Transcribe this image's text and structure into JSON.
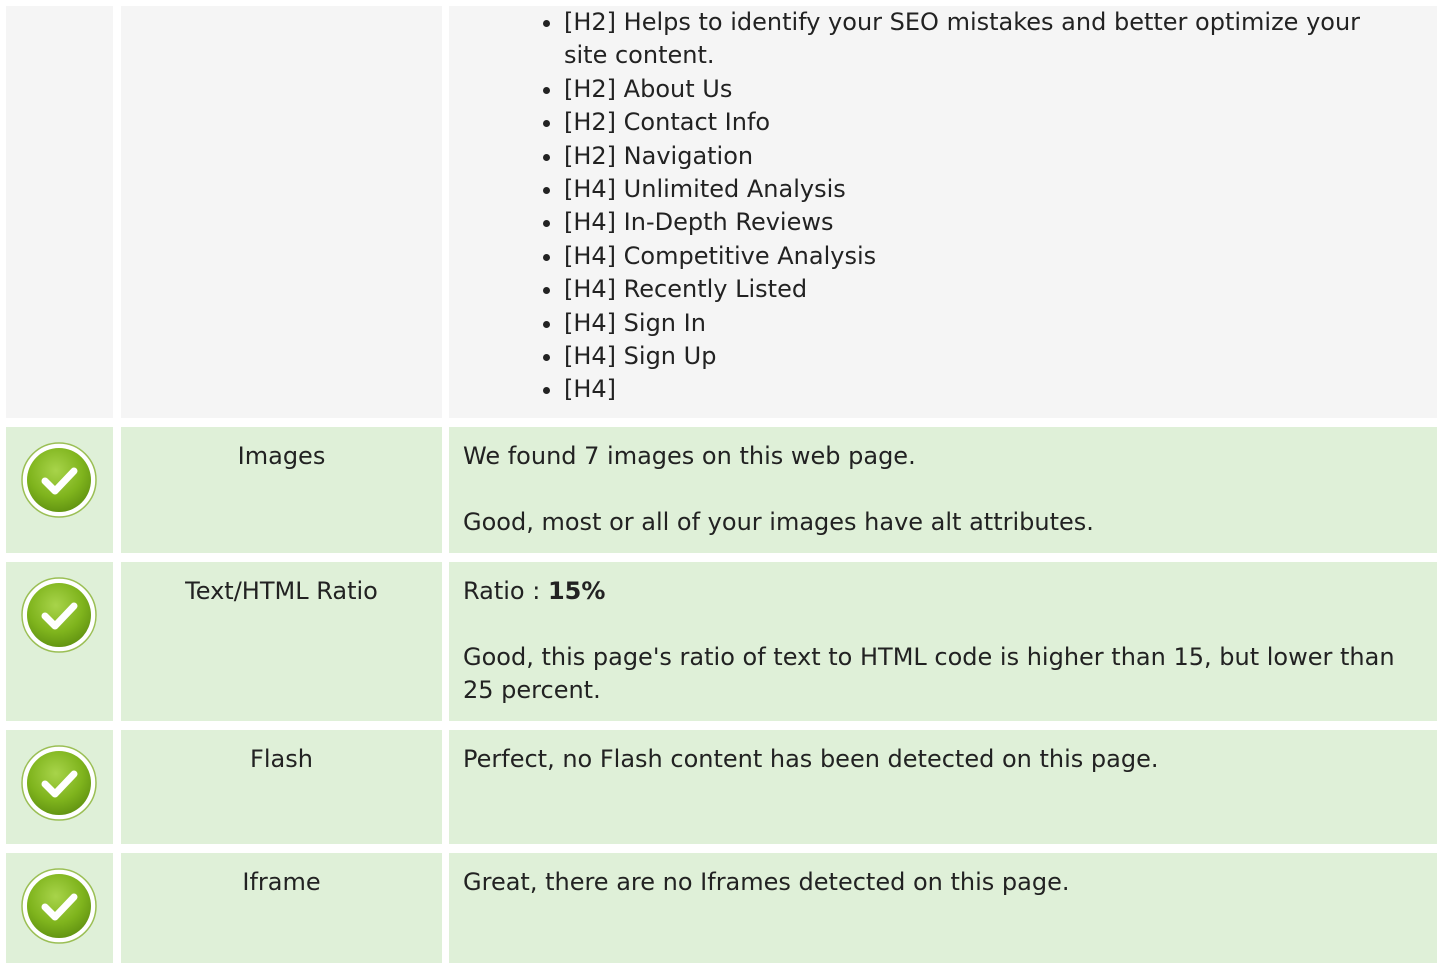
{
  "headings": {
    "items": [
      "[H2] Helps to identify your SEO mistakes and better optimize your site content.",
      "[H2] About Us",
      "[H2] Contact Info",
      "[H2] Navigation",
      "[H4] Unlimited Analysis",
      "[H4] In-Depth Reviews",
      "[H4] Competitive Analysis",
      "[H4] Recently Listed",
      "[H4] Sign In",
      "[H4] Sign Up",
      "[H4]"
    ]
  },
  "rows": [
    {
      "name": "Images",
      "status_icon": "check-circle-icon",
      "line1": "We found 7 images on this web page.",
      "line2": "Good, most or all of your images have alt attributes."
    },
    {
      "name": "Text/HTML Ratio",
      "status_icon": "check-circle-icon",
      "ratio_label": "Ratio : ",
      "ratio_value": "15%",
      "line2": "Good, this page's ratio of text to HTML code is higher than 15, but lower than 25 percent."
    },
    {
      "name": "Flash",
      "status_icon": "check-circle-icon",
      "line1": "Perfect, no Flash content has been detected on this page."
    },
    {
      "name": "Iframe",
      "status_icon": "check-circle-icon",
      "line1": "Great, there are no Iframes detected on this page."
    }
  ],
  "colors": {
    "pass_row_bg": "#dff0d8",
    "neutral_row_bg": "#f5f5f5",
    "check_green": "#7fb41d"
  }
}
